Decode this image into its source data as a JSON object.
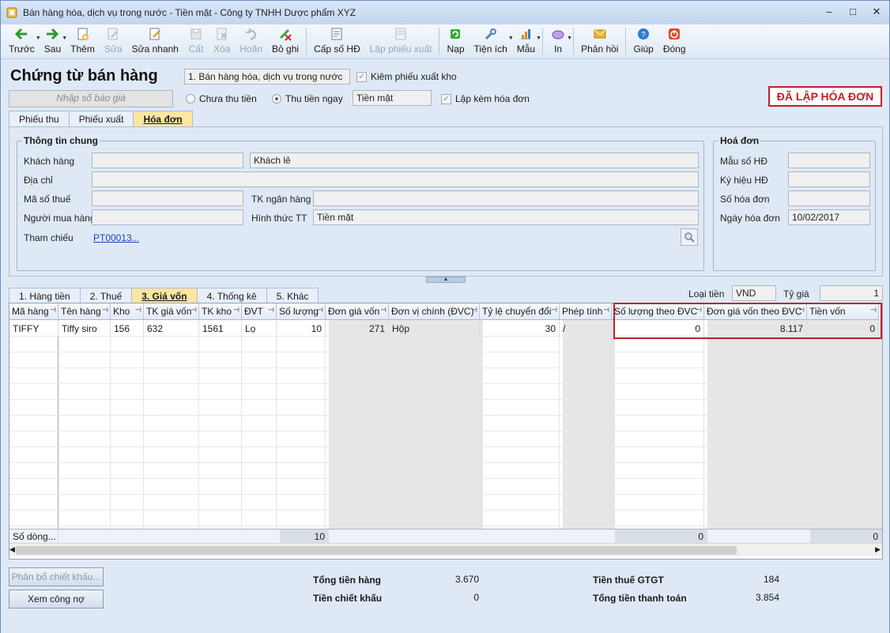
{
  "window": {
    "title": "Bán hàng hóa, dịch vụ trong nước - Tiền mặt - Công ty TNHH Dược phẩm XYZ",
    "minimize": "–",
    "maximize": "□",
    "close": "✕"
  },
  "toolbar": {
    "items": [
      {
        "label": "Trước",
        "icon": "arrow-left-icon",
        "enabled": true,
        "dropdown": true
      },
      {
        "label": "Sau",
        "icon": "arrow-right-icon",
        "enabled": true,
        "dropdown": true
      },
      {
        "label": "Thêm",
        "icon": "add-doc-icon",
        "enabled": true
      },
      {
        "label": "Sửa",
        "icon": "edit-icon",
        "enabled": false
      },
      {
        "label": "Sửa nhanh",
        "icon": "quick-edit-icon",
        "enabled": true
      },
      {
        "label": "Cất",
        "icon": "save-icon",
        "enabled": false
      },
      {
        "label": "Xóa",
        "icon": "delete-icon",
        "enabled": false
      },
      {
        "label": "Hoãn",
        "icon": "undo-icon",
        "enabled": false
      },
      {
        "label": "Bỏ ghi",
        "icon": "unpost-icon",
        "enabled": true
      },
      {
        "label": "Cấp số HĐ",
        "icon": "invoice-number-icon",
        "enabled": true
      },
      {
        "label": "Lập phiếu xuất",
        "icon": "issue-slip-icon",
        "enabled": false
      },
      {
        "label": "Nạp",
        "icon": "reload-icon",
        "enabled": true
      },
      {
        "label": "Tiện ích",
        "icon": "utilities-icon",
        "enabled": true,
        "dropdown": true
      },
      {
        "label": "Mẫu",
        "icon": "template-icon",
        "enabled": true,
        "dropdown": true
      },
      {
        "label": "In",
        "icon": "print-icon",
        "enabled": true,
        "dropdown": true
      },
      {
        "label": "Phản hồi",
        "icon": "feedback-icon",
        "enabled": true
      },
      {
        "label": "Giúp",
        "icon": "help-icon",
        "enabled": true
      },
      {
        "label": "Đóng",
        "icon": "close-doc-icon",
        "enabled": true
      }
    ]
  },
  "header": {
    "title": "Chứng từ bán hàng",
    "transaction_type": "1. Bán hàng hóa, dịch vụ trong nước",
    "check_export_slip": "Kiêm phiếu xuất kho",
    "quote_placeholder": "Nhập số báo giá",
    "radio_unpaid": "Chưa thu tiền",
    "radio_paid": "Thu tiền ngay",
    "payment_method": "Tiền mặt",
    "check_with_invoice": "Lập kèm hóa đơn",
    "invoice_status": "ĐÃ LẬP HÓA ĐƠN"
  },
  "top_tabs": [
    {
      "label": "Phiếu thu",
      "active": false
    },
    {
      "label": "Phiếu xuất",
      "active": false
    },
    {
      "label": "Hóa đơn",
      "active": true
    }
  ],
  "general_info": {
    "group_title": "Thông tin chung",
    "customer_label": "Khách hàng",
    "customer_code": "",
    "customer_name": "Khách lẻ",
    "address_label": "Địa chỉ",
    "address": "",
    "tax_code_label": "Mã số thuế",
    "tax_code": "",
    "bank_account_label": "TK ngân hàng",
    "bank_account": "",
    "buyer_label": "Người mua hàng",
    "buyer": "",
    "payment_form_label": "Hình thức TT",
    "payment_form": "Tiền mặt",
    "reference_label": "Tham chiếu",
    "reference_link": "PT00013",
    "reference_more": "..."
  },
  "invoice_info": {
    "group_title": "Hoá đơn",
    "form_no_label": "Mẫu số HĐ",
    "form_no": "",
    "symbol_label": "Ký hiệu HĐ",
    "symbol": "",
    "invoice_no_label": "Số hóa đơn",
    "invoice_no": "",
    "invoice_date_label": "Ngày hóa đơn",
    "invoice_date": "10/02/2017"
  },
  "detail_tabs": [
    {
      "label": "1. Hàng tiền",
      "active": false
    },
    {
      "label": "2. Thuế",
      "active": false
    },
    {
      "label": "3. Giá vốn",
      "active": true
    },
    {
      "label": "4. Thống kê",
      "active": false
    },
    {
      "label": "5. Khác",
      "active": false
    }
  ],
  "currency": {
    "currency_label": "Loại tiền",
    "currency_value": "VND",
    "rate_label": "Tỷ giá",
    "rate_value": "1"
  },
  "grid": {
    "columns": [
      "Mã hàng",
      "Tên hàng",
      "Kho",
      "TK giá vốn",
      "TK kho",
      "ĐVT",
      "Số lượng",
      "Đơn giá vốn",
      "Đơn vị chính (ĐVC)",
      "Tỷ lệ chuyển đổi",
      "Phép tính",
      "Số lượng theo ĐVC",
      "Đơn giá vốn theo ĐVC",
      "Tiền vốn"
    ],
    "rows": [
      [
        "TIFFY",
        "Tiffy siro",
        "156",
        "632",
        "1561",
        "Lọ",
        "10",
        "271",
        "Hộp",
        "30",
        "/",
        "0",
        "8.117",
        "0"
      ]
    ],
    "footer_label": "Số dòng...",
    "footer_qty": "10",
    "footer_qty_dvc": "0",
    "footer_cost": "0"
  },
  "bottom": {
    "allocate_discount": "Phân bổ chiết khấu...",
    "view_debt": "Xem công nợ",
    "total_goods_label": "Tổng tiền hàng",
    "total_goods": "3.670",
    "discount_label": "Tiền chiết khấu",
    "discount": "0",
    "vat_label": "Tiền thuế GTGT",
    "vat": "184",
    "total_payment_label": "Tổng tiền thanh toán",
    "total_payment": "3.854"
  }
}
